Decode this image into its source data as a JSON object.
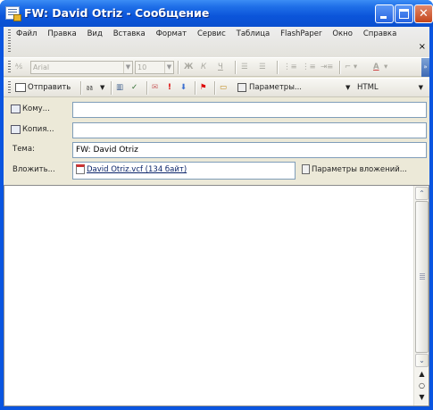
{
  "window": {
    "title": "FW: David Otriz - Сообщение"
  },
  "menu": {
    "items": [
      "Файл",
      "Правка",
      "Вид",
      "Вставка",
      "Формат",
      "Сервис",
      "Таблица",
      "FlashPaper",
      "Окно",
      "Справка"
    ],
    "close_symbol": "×"
  },
  "formatting_toolbar": {
    "font": "Arial",
    "size": "10",
    "bold": "Ж",
    "italic": "К",
    "underline": "Ч",
    "font_color": "A"
  },
  "standard_toolbar": {
    "send_label": "Отправить",
    "options_label": "Параметры...",
    "format_label": "HTML"
  },
  "headers": {
    "to_button": "Кому...",
    "cc_button": "Копия...",
    "subject_label": "Тема:",
    "subject_value": "FW: David Otriz",
    "attach_button": "Вложить...",
    "attachment_file": "David Otriz.vcf (134 байт)",
    "attach_options": "Параметры вложений..."
  },
  "colors": {
    "titlebar": "#0a55e0",
    "frame": "#ece9d8",
    "close_button": "#c4461c"
  }
}
